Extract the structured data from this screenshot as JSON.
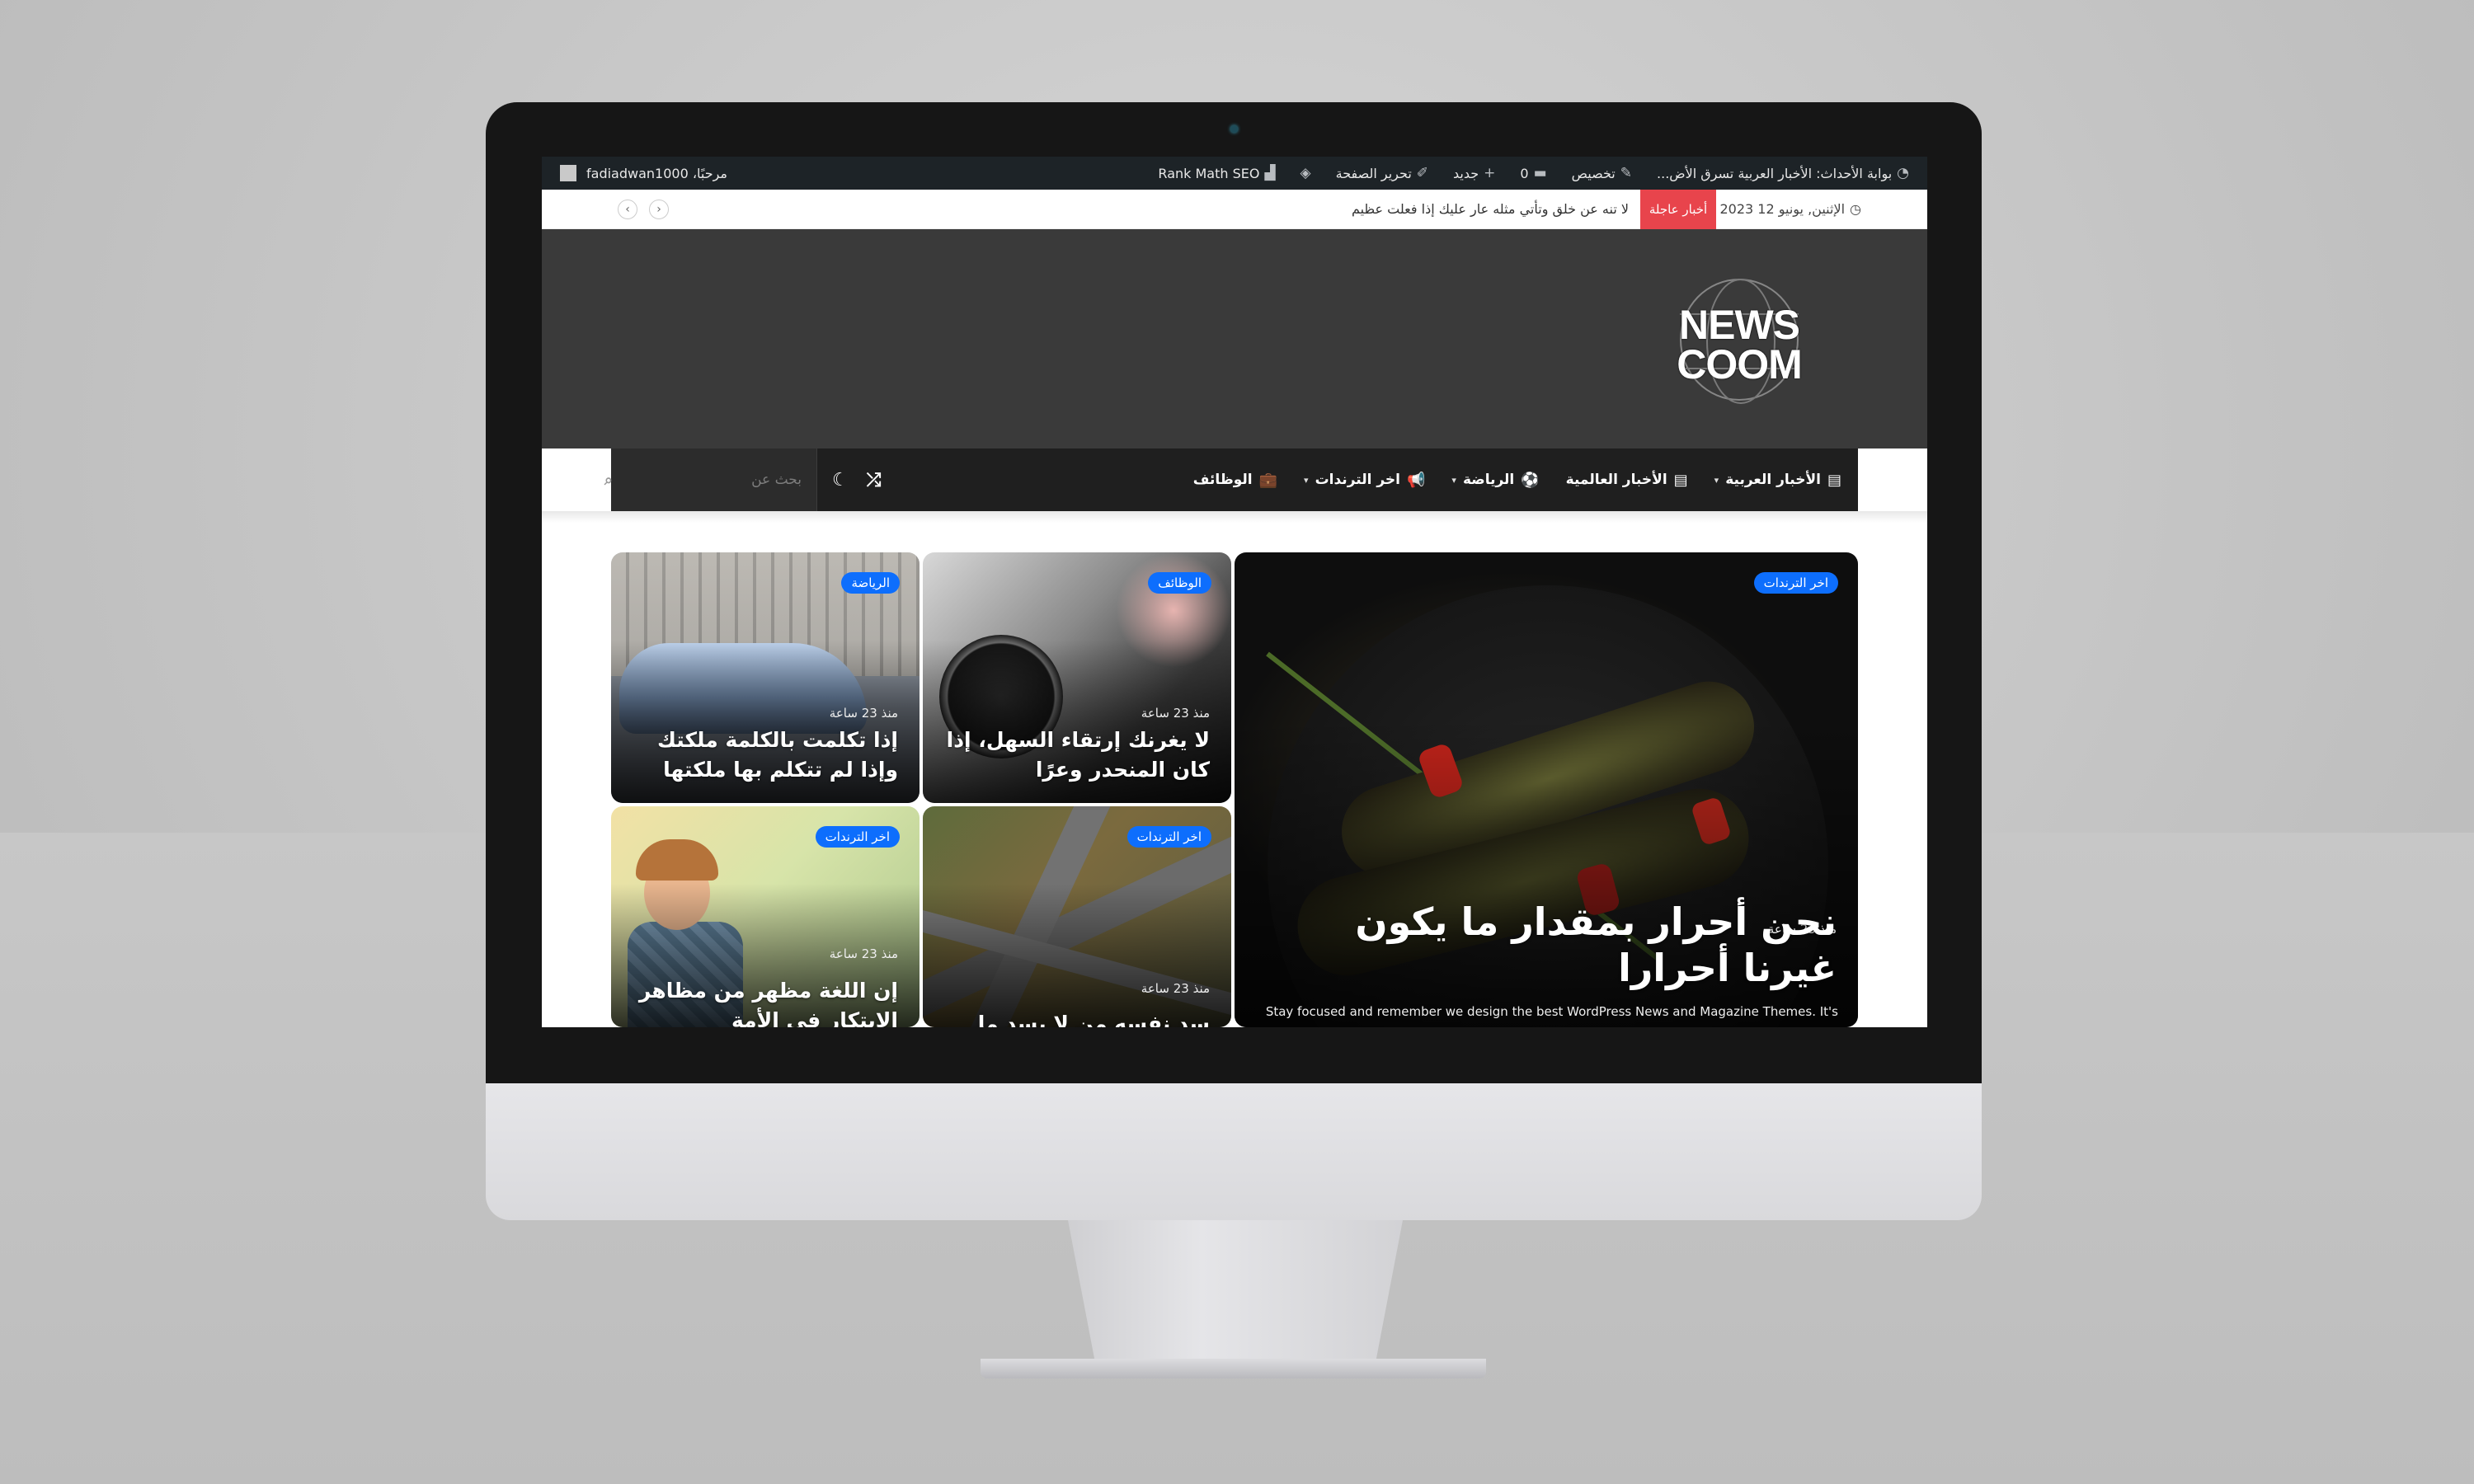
{
  "admin_bar": {
    "site_name": "بوابة الأحداث: الأخبار العربية تسرق الأض...",
    "customize": "تخصيص",
    "comments_count": "0",
    "new": "جديد",
    "edit_page": "تحرير الصفحة",
    "rank_math": "Rank Math SEO",
    "greeting": "مرحبًا، fadiadwan1000"
  },
  "top_bar": {
    "date": "الإثنين, يونيو 12 2023",
    "breaking_label": "أخبار عاجلة",
    "breaking_text": "لا تنه عن خلق وتأتي مثله عار عليك إذا فعلت عظيم",
    "prev": "‹",
    "next": "›"
  },
  "logo": {
    "line1": "NEWS",
    "line2": "COOM"
  },
  "nav": {
    "items": [
      {
        "label": "الأخبار العربية",
        "icon": "newspaper-icon"
      },
      {
        "label": "الأخبار العالمية",
        "icon": "newspaper-icon"
      },
      {
        "label": "الرياضة",
        "icon": "soccer-ball-icon"
      },
      {
        "label": "اخر الترندات",
        "icon": "megaphone-icon"
      },
      {
        "label": "الوظائف",
        "icon": "briefcase-icon"
      }
    ],
    "search_placeholder": "بحث عن"
  },
  "posts": [
    {
      "badge": "اخر الترندات",
      "time": "منذ 23 ساعة",
      "title": "نحن أحرار بمقدار ما يكون غيرنا أحرارا",
      "excerpt": "Stay focused and remember we design the best WordPress News and Magazine Themes. It's"
    },
    {
      "badge": "الوظائف",
      "time": "منذ 23 ساعة",
      "title": "لا يغرنك إرتقاء السهل، إذا كان المنحدر وعرًا"
    },
    {
      "badge": "الرياضة",
      "time": "منذ 23 ساعة",
      "title": "إذا تكلمت بالكلمة ملكتك وإذا لم تتكلم بها ملكتها"
    },
    {
      "badge": "اخر الترندات",
      "time": "منذ 23 ساعة",
      "title": "إن اللغة مظهر من مظاهر الابتكار في الأمة"
    },
    {
      "badge": "اخر الترندات",
      "time": "منذ 23 ساعة",
      "title": "سد نفسه من لا يسد ما"
    }
  ],
  "colors": {
    "accent": "#0d6efd",
    "breaking": "#e8444c",
    "header": "#3a3a3a",
    "nav": "#1f1f1f"
  }
}
